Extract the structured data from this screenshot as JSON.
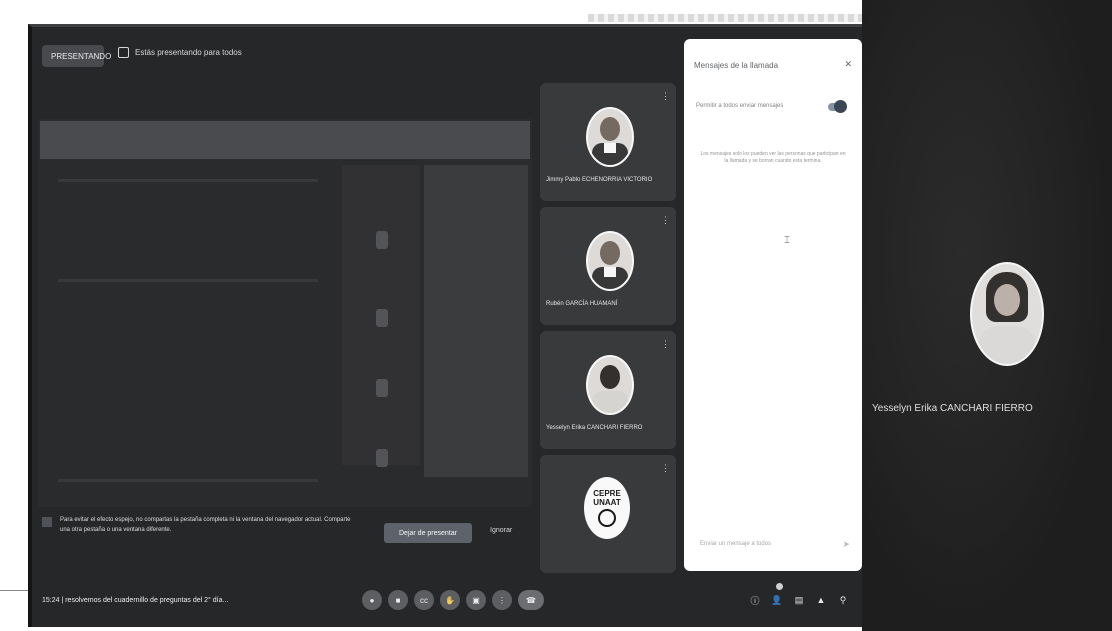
{
  "header": {
    "presenting_label": "PRESENTANDO",
    "presenting_message": "Estás presentando para todos"
  },
  "participants": [
    {
      "name": "Jimmy Pablo ECHENORRIA VICTORIO"
    },
    {
      "name": "Rubén GARCÍA HUAMANÍ"
    },
    {
      "name": "Yesselyn Erika CANCHARI FIERRO"
    },
    {
      "logo_lines": [
        "CEPRE",
        "UNAAT"
      ]
    }
  ],
  "chat": {
    "title": "Mensajes de la llamada",
    "toggle_label": "Permitir a todos enviar mensajes",
    "info": "Los mensajes solo los pueden ver las personas que participan en la llamada y se borran cuando esta termina.",
    "input_placeholder": "Enviar un mensaje a todos"
  },
  "notice": {
    "text": "Para evitar el efecto espejo, no compartas la pestaña completa ni la ventana del navegador actual. Comparte una otra pestaña o una ventana diferente.",
    "fix_button": "Dejar de presentar",
    "ignore_button": "Ignorar"
  },
  "bottombar": {
    "time_text": "15:24 | resolvemos del cuadernillo de preguntas del 2° día..."
  },
  "controls": [
    "mic-icon",
    "camera-icon",
    "captions-icon",
    "raise-hand-icon",
    "present-icon",
    "more-icon",
    "end-call-icon"
  ],
  "right_controls": [
    "info-icon",
    "people-icon",
    "chat-icon",
    "activities-icon",
    "lock-icon"
  ],
  "spotlight": {
    "name": "Yesselyn Erika CANCHARI FIERRO"
  },
  "colors": {
    "chat_bg": "#ffffff",
    "meet_bg": "#2a2b2d",
    "tile_bg": "#3c3d40"
  }
}
